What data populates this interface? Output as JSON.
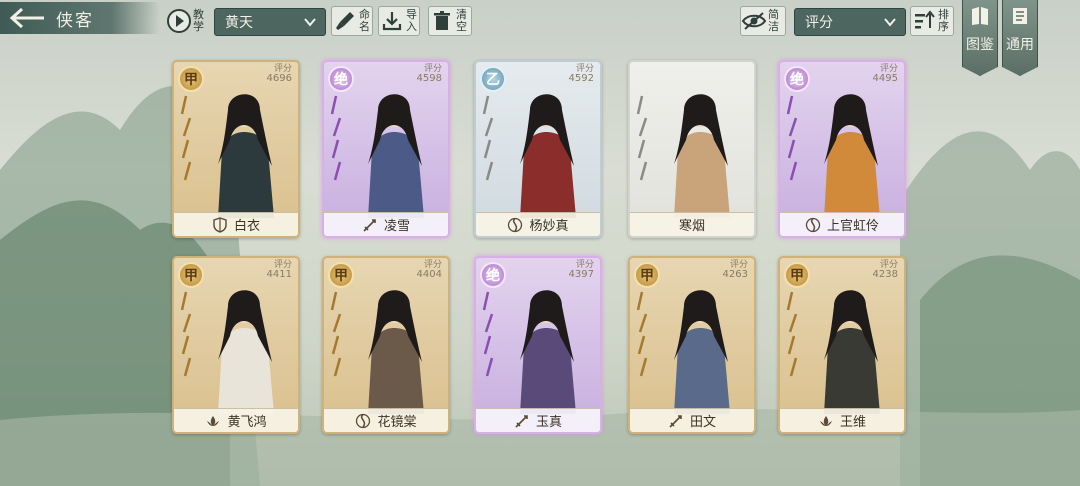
{
  "header": {
    "title": "侠客",
    "teach_label": "教学",
    "filter_select": "黄天",
    "rename_label": "命名",
    "import_label": "导入",
    "clear_label": "清空",
    "simple_label": "简洁",
    "sort_select": "评分",
    "order_label": "排序",
    "codex_label": "图鉴",
    "common_label": "通用"
  },
  "score_label": "评分",
  "cards": [
    {
      "name": "白衣",
      "grade": "甲",
      "score": "4696",
      "rarity": "gold",
      "icon": "shield-icon"
    },
    {
      "name": "凌雪",
      "grade": "绝",
      "score": "4598",
      "rarity": "purple",
      "icon": "sword-icon"
    },
    {
      "name": "杨妙真",
      "grade": "乙",
      "score": "4592",
      "rarity": "blue",
      "icon": "swirl-icon"
    },
    {
      "name": "寒烟",
      "grade": "",
      "score": "",
      "rarity": "white",
      "icon": ""
    },
    {
      "name": "上官虹伶",
      "grade": "绝",
      "score": "4495",
      "rarity": "purple",
      "icon": "swirl-icon"
    },
    {
      "name": "黄飞鸿",
      "grade": "甲",
      "score": "4411",
      "rarity": "gold",
      "icon": "lotus-icon"
    },
    {
      "name": "花镜棠",
      "grade": "甲",
      "score": "4404",
      "rarity": "gold",
      "icon": "swirl-icon"
    },
    {
      "name": "玉真",
      "grade": "绝",
      "score": "4397",
      "rarity": "purple",
      "icon": "sword-icon"
    },
    {
      "name": "田文",
      "grade": "甲",
      "score": "4263",
      "rarity": "gold",
      "icon": "sword-icon"
    },
    {
      "name": "王维",
      "grade": "甲",
      "score": "4238",
      "rarity": "gold",
      "icon": "lotus-icon"
    }
  ],
  "colors": {
    "gold_card": "#d9bf8c",
    "purple_card": "#c6aede",
    "topbar_dark": "#4d6660"
  }
}
